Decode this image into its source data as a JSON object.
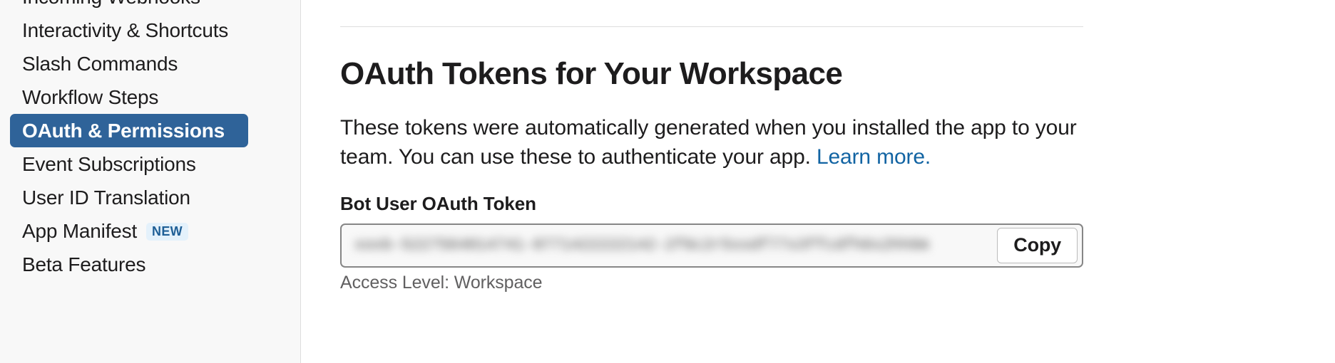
{
  "sidebar": {
    "items": [
      {
        "label": "Incoming Webhooks",
        "active": false,
        "badge": null
      },
      {
        "label": "Interactivity & Shortcuts",
        "active": false,
        "badge": null
      },
      {
        "label": "Slash Commands",
        "active": false,
        "badge": null
      },
      {
        "label": "Workflow Steps",
        "active": false,
        "badge": null
      },
      {
        "label": "OAuth & Permissions",
        "active": true,
        "badge": null
      },
      {
        "label": "Event Subscriptions",
        "active": false,
        "badge": null
      },
      {
        "label": "User ID Translation",
        "active": false,
        "badge": null
      },
      {
        "label": "App Manifest",
        "active": false,
        "badge": "NEW"
      },
      {
        "label": "Beta Features",
        "active": false,
        "badge": null
      }
    ],
    "active_color": "#2f6399",
    "badge_bg_color": "#e4f1fb",
    "badge_text_color": "#1f5f96"
  },
  "main": {
    "section_title": "OAuth Tokens for Your Workspace",
    "description_text": "These tokens were automatically generated when you installed the app to your team. You can use these to authenticate your app. ",
    "description_link_label": "Learn more.",
    "link_color": "#1264a3",
    "token_field": {
      "label": "Bot User OAuth Token",
      "value": "xoxb-5227564014741-0771422222142-2f6c2r5ssdf77s3ffcdfh6s2hh6m",
      "copy_label": "Copy"
    },
    "access_level_text": "Access Level: Workspace"
  }
}
